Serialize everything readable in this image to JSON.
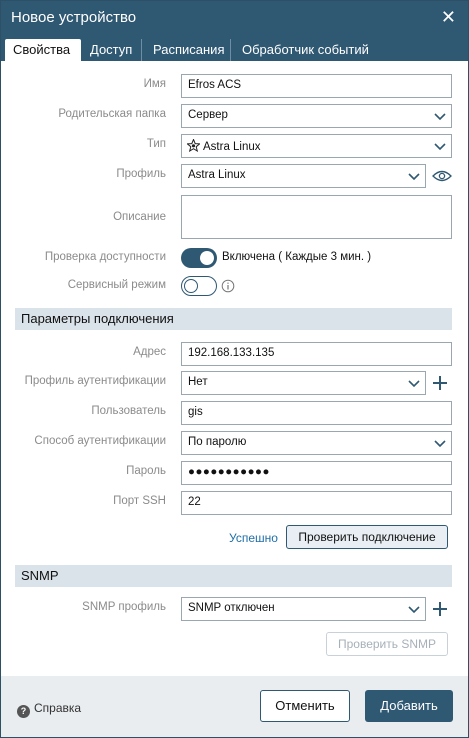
{
  "window": {
    "title": "Новое устройство",
    "close_glyph": "✕"
  },
  "tabs": [
    {
      "label": "Свойства",
      "active": true
    },
    {
      "label": "Доступ",
      "active": false
    },
    {
      "label": "Расписания",
      "active": false
    },
    {
      "label": "Обработчик событий",
      "active": false
    }
  ],
  "properties": {
    "name": {
      "label": "Имя",
      "value": "Efros ACS"
    },
    "parent_folder": {
      "label": "Родительская папка",
      "value": "Сервер"
    },
    "type": {
      "label": "Тип",
      "value": "Astra Linux",
      "icon": "astra-star-icon"
    },
    "profile": {
      "label": "Профиль",
      "value": "Astra Linux"
    },
    "description": {
      "label": "Описание",
      "value": ""
    },
    "availability": {
      "label": "Проверка доступности",
      "enabled": true,
      "status_text": "Включена ( Каждые 3 мин. )"
    },
    "service_mode": {
      "label": "Сервисный режим",
      "enabled": false
    }
  },
  "connection": {
    "section_title": "Параметры подключения",
    "address": {
      "label": "Адрес",
      "value": "192.168.133.135"
    },
    "auth_profile": {
      "label": "Профиль аутентификации",
      "value": "Нет"
    },
    "user": {
      "label": "Пользователь",
      "value": "gis"
    },
    "auth_method": {
      "label": "Способ аутентификации",
      "value": "По паролю"
    },
    "password": {
      "label": "Пароль",
      "value": "●●●●●●●●●●●"
    },
    "ssh_port": {
      "label": "Порт SSH",
      "value": "22"
    },
    "status_text": "Успешно",
    "check_button": "Проверить подключение"
  },
  "snmp": {
    "section_title": "SNMP",
    "profile": {
      "label": "SNMP профиль",
      "value": "SNMP отключен"
    },
    "check_button": "Проверить SNMP"
  },
  "footer": {
    "help_label": "Справка",
    "cancel_label": "Отменить",
    "add_label": "Добавить"
  },
  "colors": {
    "accent": "#2f5873",
    "section_bg": "#dbe3ea",
    "success": "#1f6fa8"
  }
}
